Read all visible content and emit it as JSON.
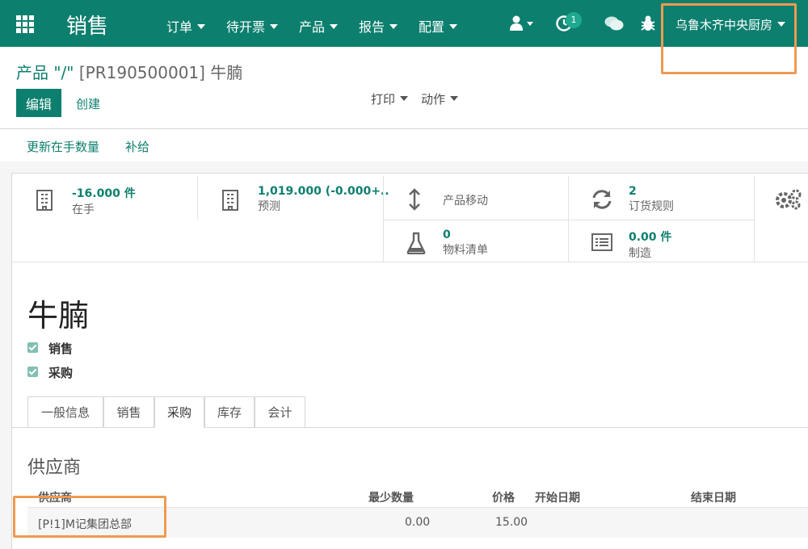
{
  "navbar": {
    "brand": "销售",
    "menus": [
      "订单",
      "待开票",
      "产品",
      "报告",
      "配置"
    ],
    "activity_count": "1",
    "company": "乌鲁木齐中央厨房"
  },
  "breadcrumb": {
    "parent": "产品 \"/\"",
    "current": "[PR190500001] 牛腩"
  },
  "buttons": {
    "edit": "编辑",
    "create": "创建"
  },
  "dropdowns": {
    "print": "打印",
    "action": "动作"
  },
  "header_actions": {
    "update_qty": "更新在手数量",
    "replenish": "补给"
  },
  "stat_buttons": {
    "on_hand": {
      "value": "-16.000 件",
      "label": "在手"
    },
    "forecast": {
      "value": "1,019.000 (-0.000+..",
      "label": "预测"
    },
    "moves": {
      "label": "产品移动"
    },
    "reorder": {
      "value": "2",
      "label": "订货规则"
    },
    "bom": {
      "value": "0",
      "label": "物料清单"
    },
    "manufacture": {
      "value": "0.00 件",
      "label": "制造"
    }
  },
  "product": {
    "name": "牛腩",
    "sale_ok": "销售",
    "purchase_ok": "采购"
  },
  "tabs": [
    "一般信息",
    "销售",
    "采购",
    "库存",
    "会计"
  ],
  "active_tab": "采购",
  "vendors": {
    "section_title": "供应商",
    "columns": {
      "vendor": "供应商",
      "min_qty": "最少数量",
      "price": "价格",
      "start": "开始日期",
      "end": "结束日期"
    },
    "rows": [
      {
        "vendor": "[P!1]M记集团总部",
        "min_qty": "0.00",
        "price": "15.00"
      }
    ]
  },
  "colors": {
    "brand": "#0d7f6e",
    "highlight": "#ef9a50",
    "badge": "#1fa98f"
  }
}
